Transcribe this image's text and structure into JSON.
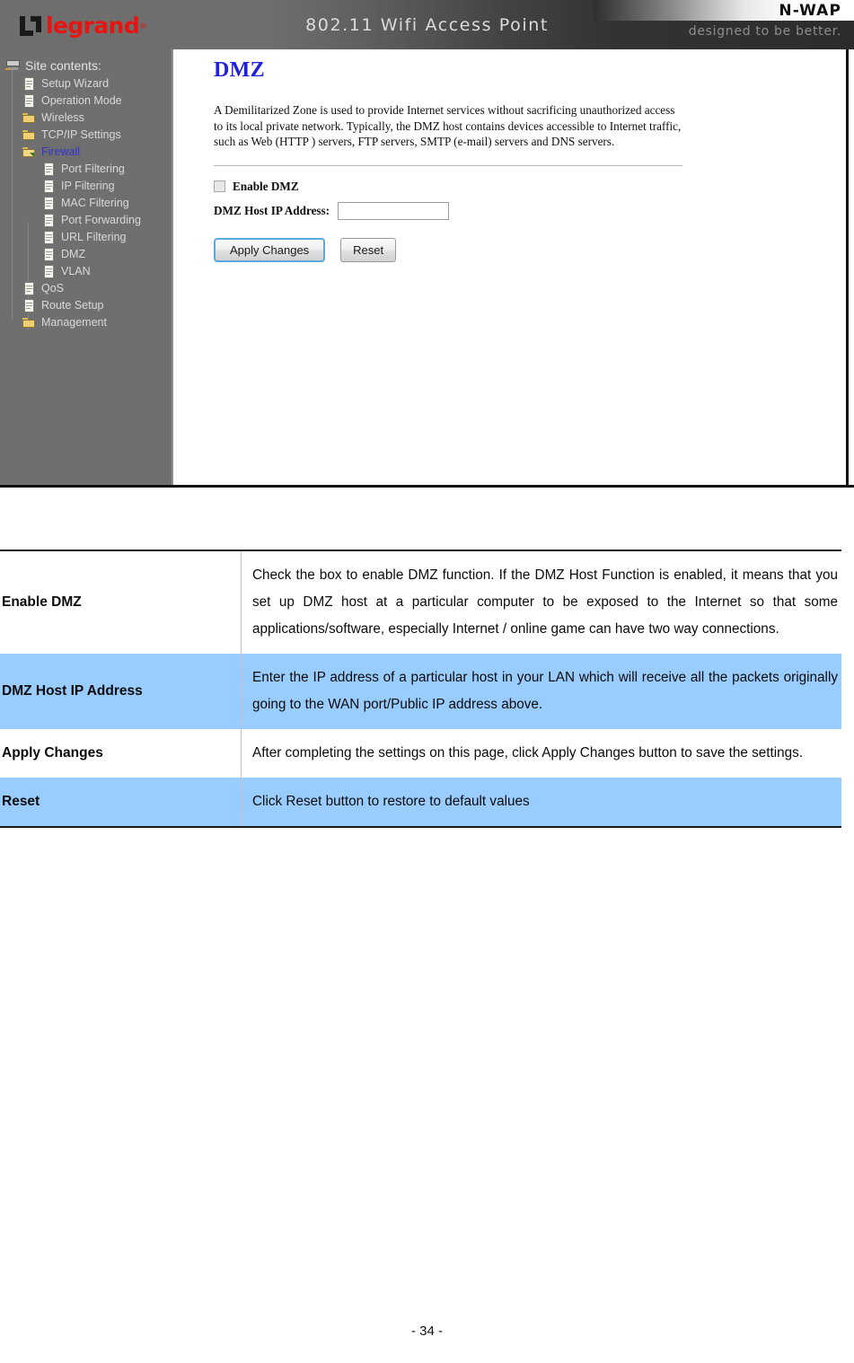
{
  "screenshot": {
    "banner": {
      "logo_text": "legrand",
      "logo_reg": "®",
      "product_title": "802.11 Wifi Access Point",
      "model_badge": "N-WAP",
      "tagline": "designed to be better."
    },
    "sidebar": {
      "root_label": "Site contents:",
      "items": [
        {
          "label": "Setup Wizard",
          "icon": "document-icon",
          "indent": 1,
          "selected": false
        },
        {
          "label": "Operation Mode",
          "icon": "document-icon",
          "indent": 1,
          "selected": false
        },
        {
          "label": "Wireless",
          "icon": "folder-icon",
          "indent": 1,
          "selected": false
        },
        {
          "label": "TCP/IP Settings",
          "icon": "folder-icon",
          "indent": 1,
          "selected": false
        },
        {
          "label": "Firewall",
          "icon": "folder-open-icon",
          "indent": 1,
          "selected": true
        },
        {
          "label": "Port Filtering",
          "icon": "document-icon",
          "indent": 2,
          "selected": false
        },
        {
          "label": "IP Filtering",
          "icon": "document-icon",
          "indent": 2,
          "selected": false
        },
        {
          "label": "MAC Filtering",
          "icon": "document-icon",
          "indent": 2,
          "selected": false
        },
        {
          "label": "Port Forwarding",
          "icon": "document-icon",
          "indent": 2,
          "selected": false
        },
        {
          "label": "URL Filtering",
          "icon": "document-icon",
          "indent": 2,
          "selected": false
        },
        {
          "label": "DMZ",
          "icon": "document-icon",
          "indent": 2,
          "selected": false
        },
        {
          "label": "VLAN",
          "icon": "document-icon",
          "indent": 2,
          "selected": false
        },
        {
          "label": "QoS",
          "icon": "document-icon",
          "indent": 1,
          "selected": false
        },
        {
          "label": "Route Setup",
          "icon": "document-icon",
          "indent": 1,
          "selected": false
        },
        {
          "label": "Management",
          "icon": "folder-icon",
          "indent": 1,
          "selected": false
        }
      ]
    },
    "content": {
      "heading": "DMZ",
      "description": "A Demilitarized Zone is used to provide Internet services without sacrificing unauthorized access to its local private network. Typically, the DMZ host contains devices accessible to Internet traffic, such as Web (HTTP ) servers, FTP servers, SMTP (e-mail) servers and DNS servers.",
      "enable_label": "Enable DMZ",
      "enable_checked": false,
      "host_ip_label": "DMZ Host IP Address:",
      "host_ip_value": "",
      "host_ip_placeholder": "",
      "apply_button": "Apply Changes",
      "reset_button": "Reset"
    }
  },
  "doc_table": {
    "rows": [
      {
        "term": "Enable DMZ",
        "definition": "Check the box to enable DMZ function. If the DMZ Host Function is enabled, it means that you set up DMZ host at a particular computer to be exposed to the Internet so that some applications/software, especially Internet / online game can have two way connections.",
        "highlight": false
      },
      {
        "term": "DMZ Host IP Address",
        "definition": "Enter the IP address of a particular host in your LAN which will receive all the packets originally going to the WAN port/Public IP address above.",
        "highlight": true
      },
      {
        "term": "Apply Changes",
        "definition": "After completing the settings on this page, click Apply Changes button to save the settings.",
        "highlight": false
      },
      {
        "term": "Reset",
        "definition": "Click Reset button to restore to default values",
        "highlight": true
      }
    ]
  },
  "footer": {
    "page_number": "- 34 -"
  },
  "colors": {
    "accent_blue": "#99ccff",
    "heading_blue": "#2020dd",
    "selected_node_blue": "#3333cc",
    "brand_red": "#e8140f",
    "sidebar_gray": "#6f6f6f"
  }
}
